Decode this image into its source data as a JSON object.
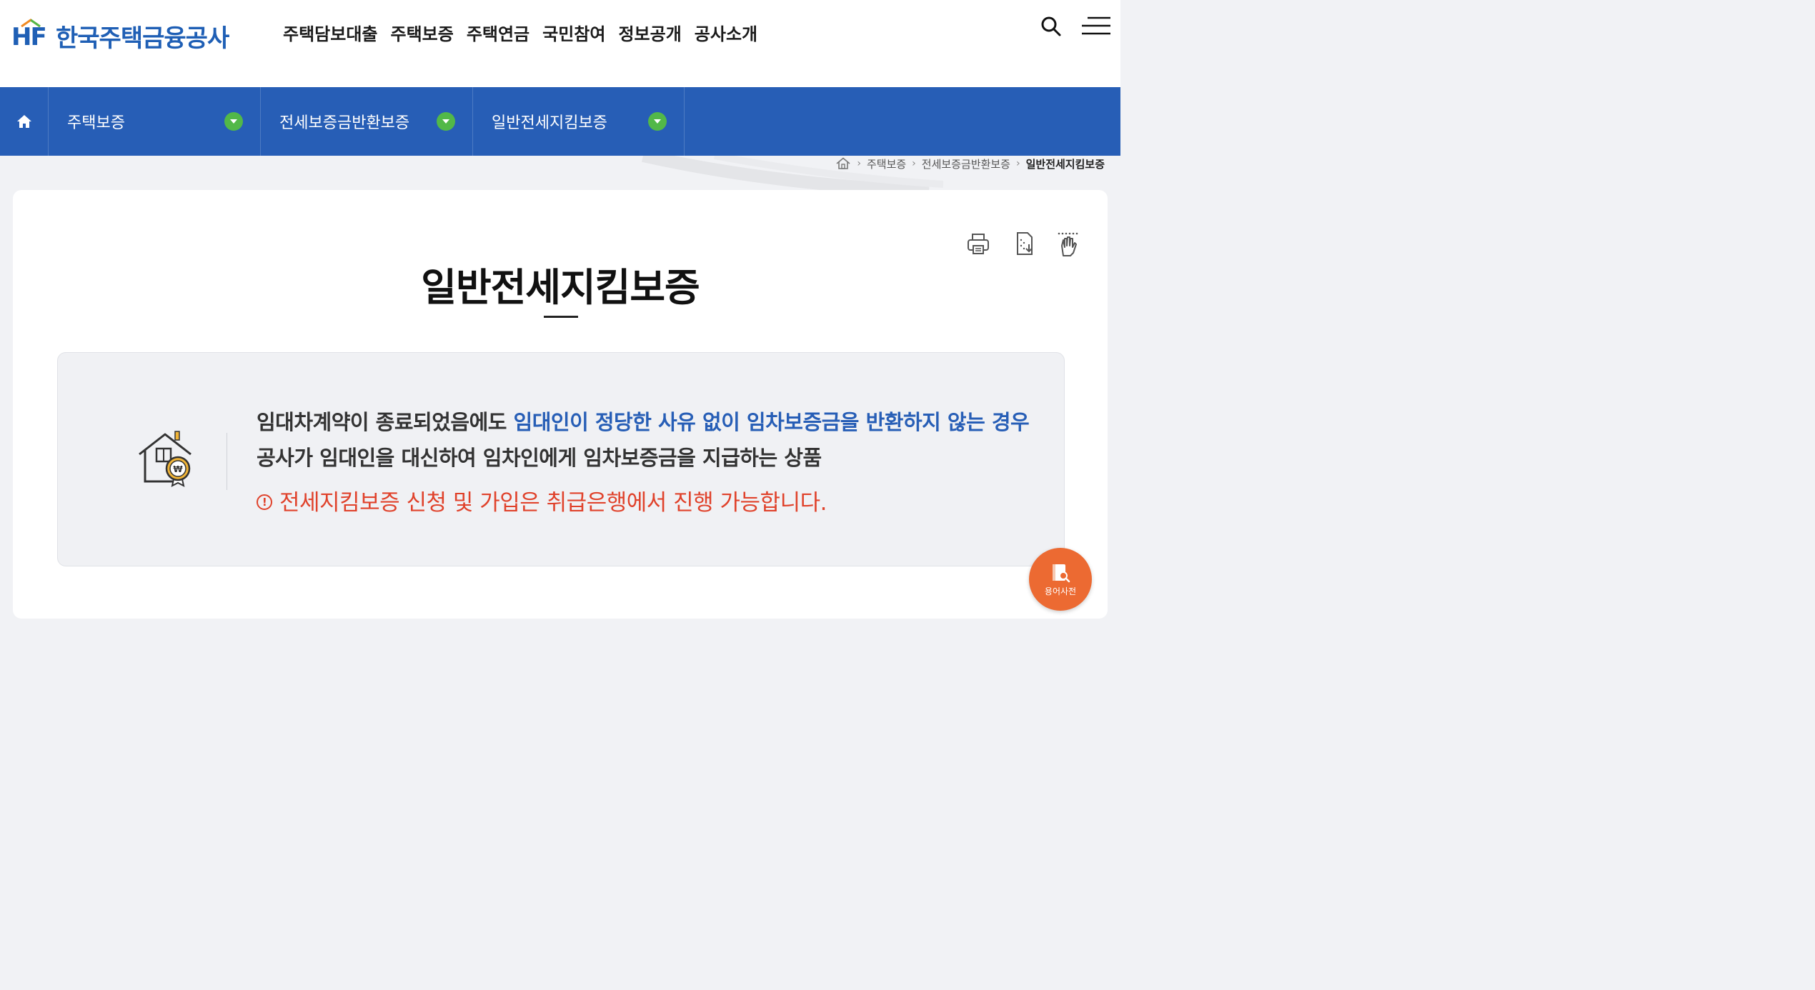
{
  "header": {
    "logo_text": "한국주택금융공사",
    "logo_mark": "HF",
    "nav": [
      "주택담보대출",
      "주택보증",
      "주택연금",
      "국민참여",
      "정보공개",
      "공사소개"
    ],
    "search_icon": "search-icon",
    "menu_icon": "hamburger-menu-icon"
  },
  "subnav": {
    "home_icon": "home-icon",
    "dropdowns": [
      {
        "label": "주택보증"
      },
      {
        "label": "전세보증금반환보증"
      },
      {
        "label": "일반전세지킴보증"
      }
    ],
    "accent": "#275eb6",
    "arrow_color": "#52b848"
  },
  "breadcrumb": {
    "items": [
      "주택보증",
      "전세보증금반환보증"
    ],
    "current": "일반전세지킴보증"
  },
  "page": {
    "title": "일반전세지킴보증",
    "utilities": [
      "print-icon",
      "download-icon",
      "sign-language-icon"
    ]
  },
  "info": {
    "line1_plain": "임대차계약이 종료되었음에도 ",
    "line1_highlight": "임대인이 정당한 사유 없이 임차보증금을 반환하지 않는 경우",
    "line2": "공사가 임대인을 대신하여 임차인에게 임차보증금을 지급하는 상품",
    "notice_mark": "!",
    "notice": "전세지킴보증 신청 및 가입은 취급은행에서 진행 가능합니다.",
    "highlight_color": "#275eb6",
    "notice_color": "#e0422b"
  },
  "floating": {
    "dict_label": "용어사전"
  }
}
